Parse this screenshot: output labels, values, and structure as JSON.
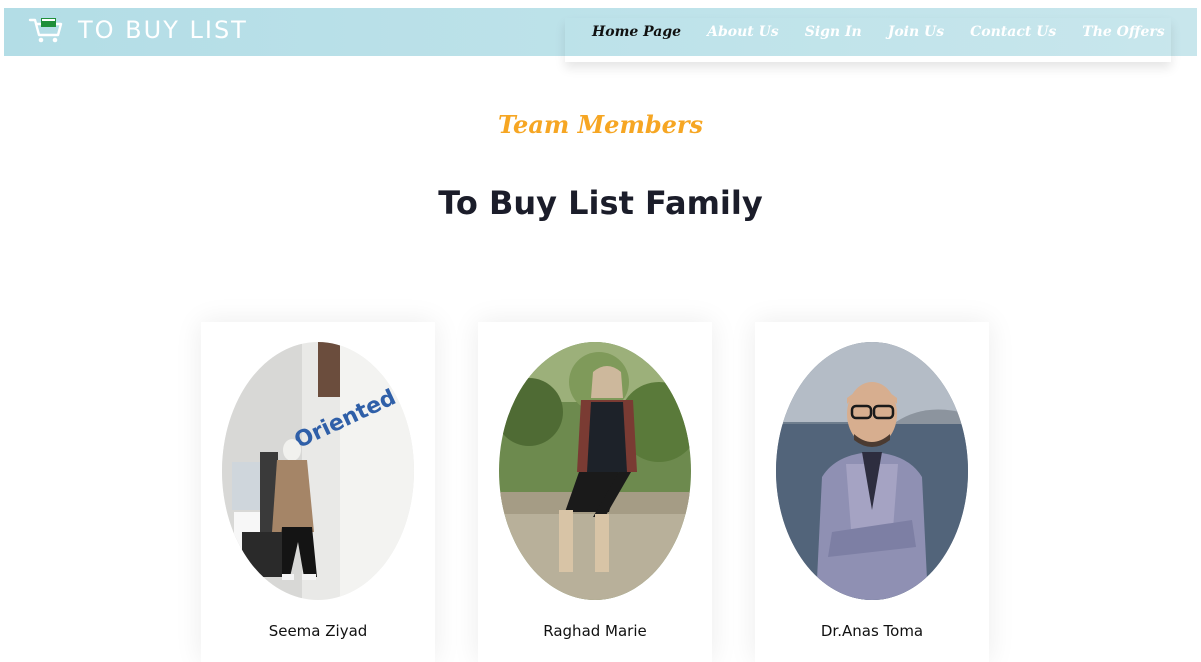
{
  "header": {
    "brand_title": "TO BUY LIST",
    "brand_icon": "shopping-cart-icon",
    "nav": [
      {
        "label": "Home Page",
        "active": true
      },
      {
        "label": "About Us",
        "active": false
      },
      {
        "label": "Sign In",
        "active": false
      },
      {
        "label": "Join Us",
        "active": false
      },
      {
        "label": "Contact Us",
        "active": false
      },
      {
        "label": "The Offers",
        "active": false
      }
    ]
  },
  "section": {
    "kicker": "Team Members",
    "heading": "To Buy List Family"
  },
  "team": [
    {
      "name": "Seema Ziyad"
    },
    {
      "name": "Raghad Marie"
    },
    {
      "name": "Dr.Anas Toma"
    }
  ],
  "colors": {
    "accent": "#f6a623",
    "navbar": "#b3dde6",
    "heading": "#1b1d2a"
  }
}
